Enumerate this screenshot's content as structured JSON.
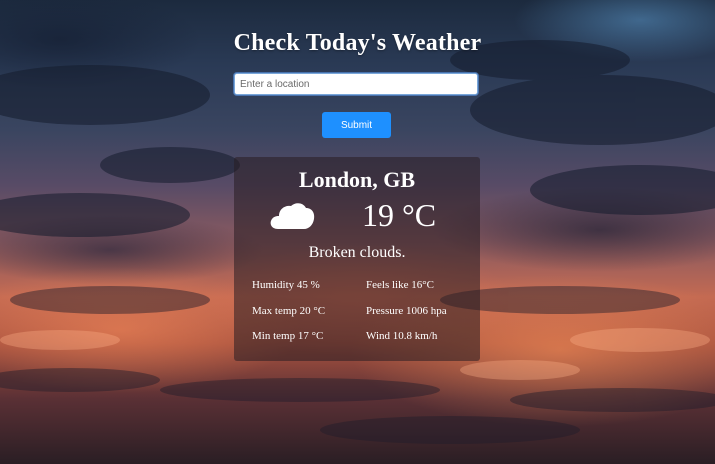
{
  "page": {
    "title": "Check Today's Weather"
  },
  "search": {
    "placeholder": "Enter a location",
    "value": "",
    "submit_label": "Submit"
  },
  "weather": {
    "city": "London, GB",
    "icon": "cloud-icon",
    "temperature": "19 °C",
    "description": "Broken clouds.",
    "stats": {
      "humidity": "Humidity 45 %",
      "feels_like": "Feels like 16°C",
      "max_temp": "Max temp 20 °C",
      "pressure": "Pressure 1006 hpa",
      "min_temp": "Min temp 17 °C",
      "wind": "Wind 10.8 km/h"
    }
  },
  "colors": {
    "accent": "#1e90ff",
    "input_focus": "#7aa7d9",
    "card_background": "rgba(40,30,35,0.55)",
    "text": "#ffffff"
  }
}
